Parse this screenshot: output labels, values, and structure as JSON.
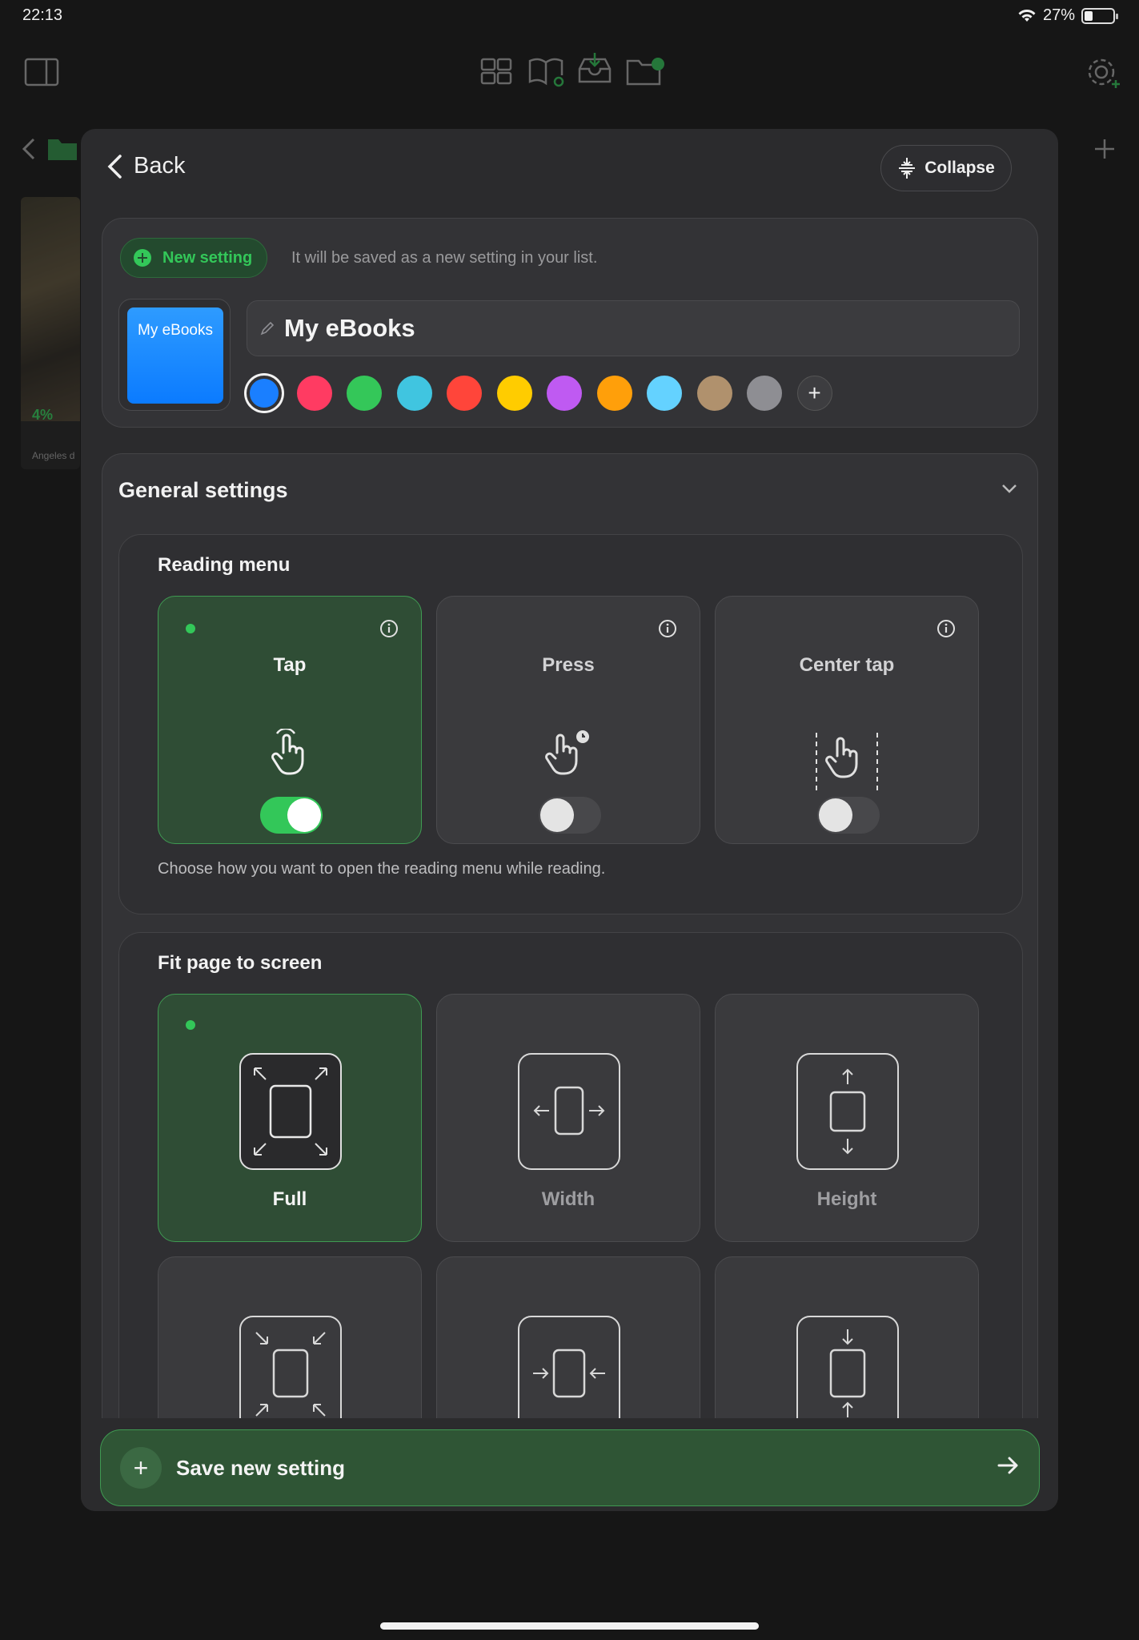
{
  "status_bar": {
    "time": "22:13",
    "battery": "27%",
    "battery_level": 0.27
  },
  "background": {
    "book": {
      "progress": "4%",
      "title": "Angeles d"
    }
  },
  "sheet": {
    "back_label": "Back",
    "collapse_label": "Collapse",
    "new_setting": {
      "pill_label": "New setting",
      "hint": "It will be saved as a new setting in your list.",
      "thumbnail_label": "My eBooks",
      "name_value": "My eBooks",
      "colors": [
        "#1a7fff",
        "#ff3b62",
        "#34c759",
        "#40c5e0",
        "#ff453a",
        "#ffcc00",
        "#bf5af2",
        "#ff9f0a",
        "#64d2ff",
        "#b0916d",
        "#8e8e93"
      ],
      "selected_color": "#1a7fff"
    },
    "general": {
      "title": "General settings",
      "reading_menu": {
        "title": "Reading menu",
        "options": [
          {
            "label": "Tap",
            "enabled": true
          },
          {
            "label": "Press",
            "enabled": false
          },
          {
            "label": "Center tap",
            "enabled": false
          }
        ],
        "description": "Choose how you want to open the reading menu while reading."
      },
      "fit_page": {
        "title": "Fit page to screen",
        "options": [
          {
            "label": "Full",
            "selected": true
          },
          {
            "label": "Width",
            "selected": false
          },
          {
            "label": "Height",
            "selected": false
          }
        ]
      }
    },
    "save_label": "Save new setting"
  }
}
